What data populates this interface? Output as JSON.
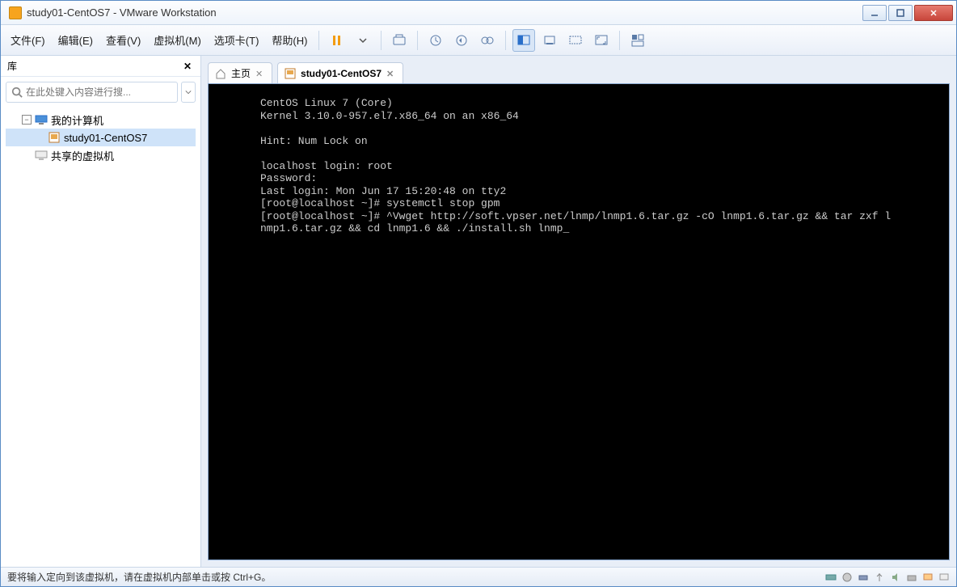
{
  "window": {
    "title": "study01-CentOS7 - VMware Workstation"
  },
  "menus": {
    "file": "文件(F)",
    "edit": "编辑(E)",
    "view": "查看(V)",
    "vm": "虚拟机(M)",
    "tabs": "选项卡(T)",
    "help": "帮助(H)"
  },
  "sidebar": {
    "title": "库",
    "search_placeholder": "在此处键入内容进行搜...",
    "nodes": {
      "my_computer": "我的计算机",
      "vm1": "study01-CentOS7",
      "shared": "共享的虚拟机"
    }
  },
  "tabs": {
    "home": "主页",
    "vm": "study01-CentOS7"
  },
  "terminal": {
    "lines": [
      "CentOS Linux 7 (Core)",
      "Kernel 3.10.0-957.el7.x86_64 on an x86_64",
      "",
      "Hint: Num Lock on",
      "",
      "localhost login: root",
      "Password:",
      "Last login: Mon Jun 17 15:20:48 on tty2",
      "[root@localhost ~]# systemctl stop gpm",
      "[root@localhost ~]# ^Vwget http://soft.vpser.net/lnmp/lnmp1.6.tar.gz -cO lnmp1.6.tar.gz && tar zxf l",
      "nmp1.6.tar.gz && cd lnmp1.6 && ./install.sh lnmp_"
    ]
  },
  "statusbar": {
    "hint": "要将输入定向到该虚拟机，请在虚拟机内部单击或按 Ctrl+G。"
  }
}
